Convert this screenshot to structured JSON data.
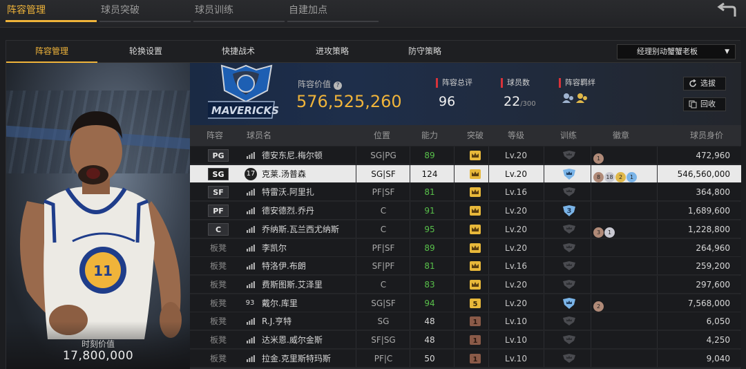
{
  "top_tabs": [
    {
      "label": "阵容管理",
      "active": true
    },
    {
      "label": "球员突破",
      "active": false
    },
    {
      "label": "球员训练",
      "active": false
    },
    {
      "label": "自建加点",
      "active": false
    }
  ],
  "sub_tabs": [
    {
      "label": "阵容管理",
      "active": true
    },
    {
      "label": "轮换设置",
      "active": false
    },
    {
      "label": "快捷战术",
      "active": false
    },
    {
      "label": "进攻策略",
      "active": false
    },
    {
      "label": "防守策略",
      "active": false
    }
  ],
  "dropdown": {
    "selected": "经理别动蟹蟹老板"
  },
  "player_card": {
    "value_label": "时刻价值",
    "value": "17,800,000"
  },
  "team": {
    "logo_icon": "mavericks-logo",
    "logo_text": "MAVERICKS",
    "lineup_value_label": "阵容价值",
    "lineup_value": "576,525,260",
    "rating_label": "阵容总评",
    "rating": "96",
    "count_label": "球员数",
    "count": "22",
    "count_max": "/300",
    "bond_label": "阵容羁绊",
    "select_button": "选拔",
    "recall_button": "回收"
  },
  "table": {
    "headers": [
      "阵容",
      "球员名",
      "位置",
      "能力",
      "突破",
      "等级",
      "训练",
      "徽章",
      "球员身价"
    ],
    "rows": [
      {
        "slot": "PG",
        "bench": false,
        "num": "",
        "name": "德安东尼.梅尔顿",
        "pos": "SG|PG",
        "ability": "89",
        "green": true,
        "brk": "crown-gold",
        "brk_text": "",
        "level": "Lv.20",
        "train": "gray",
        "train_text": "",
        "badges": [
          {
            "t": "1",
            "c": "#b08a78"
          }
        ],
        "price": "472,960",
        "selected": false
      },
      {
        "slot": "SG",
        "bench": false,
        "num": "17",
        "name": "克莱.汤普森",
        "pos": "SG|SF",
        "ability": "124",
        "green": false,
        "brk": "crown-gold",
        "brk_text": "",
        "level": "Lv.20",
        "train": "blue-crown",
        "train_text": "",
        "badges": [
          {
            "t": "8",
            "c": "#b08a78"
          },
          {
            "t": "18",
            "c": "#c9c9d2"
          },
          {
            "t": "2",
            "c": "#e0b84a"
          },
          {
            "t": "1",
            "c": "#7ab4e8"
          }
        ],
        "price": "546,560,000",
        "selected": true
      },
      {
        "slot": "SF",
        "bench": false,
        "num": "",
        "name": "特雷沃.阿里扎",
        "pos": "PF|SF",
        "ability": "81",
        "green": true,
        "brk": "crown-gold",
        "brk_text": "",
        "level": "Lv.16",
        "train": "gray",
        "train_text": "",
        "badges": [],
        "price": "364,800",
        "selected": false
      },
      {
        "slot": "PF",
        "bench": false,
        "num": "",
        "name": "德安德烈.乔丹",
        "pos": "C",
        "ability": "91",
        "green": true,
        "brk": "crown-gold",
        "brk_text": "",
        "level": "Lv.20",
        "train": "blue-num",
        "train_text": "3",
        "badges": [],
        "price": "1,689,600",
        "selected": false
      },
      {
        "slot": "C",
        "bench": false,
        "num": "",
        "name": "乔纳斯.瓦兰西尤纳斯",
        "pos": "C",
        "ability": "95",
        "green": true,
        "brk": "crown-gold",
        "brk_text": "",
        "level": "Lv.20",
        "train": "gray",
        "train_text": "",
        "badges": [
          {
            "t": "3",
            "c": "#b08a78"
          },
          {
            "t": "1",
            "c": "#c9c9d2"
          }
        ],
        "price": "1,228,800",
        "selected": false
      },
      {
        "slot": "板凳",
        "bench": true,
        "num": "",
        "name": "李凯尔",
        "pos": "PF|SF",
        "ability": "89",
        "green": true,
        "brk": "crown-gold",
        "brk_text": "",
        "level": "Lv.20",
        "train": "gray",
        "train_text": "",
        "badges": [],
        "price": "264,960",
        "selected": false
      },
      {
        "slot": "板凳",
        "bench": true,
        "num": "",
        "name": "特洛伊.布朗",
        "pos": "SF|PF",
        "ability": "81",
        "green": true,
        "brk": "crown-gold",
        "brk_text": "",
        "level": "Lv.16",
        "train": "gray",
        "train_text": "",
        "badges": [],
        "price": "259,200",
        "selected": false
      },
      {
        "slot": "板凳",
        "bench": true,
        "num": "",
        "name": "费斯图斯.艾泽里",
        "pos": "C",
        "ability": "83",
        "green": true,
        "brk": "crown-gold",
        "brk_text": "",
        "level": "Lv.20",
        "train": "gray",
        "train_text": "",
        "badges": [],
        "price": "297,600",
        "selected": false
      },
      {
        "slot": "板凳",
        "bench": true,
        "num": "93",
        "name": "戴尔.库里",
        "pos": "SG|SF",
        "ability": "94",
        "green": true,
        "brk": "num-gold",
        "brk_text": "5",
        "level": "Lv.20",
        "train": "blue-crown",
        "train_text": "",
        "badges": [
          {
            "t": "2",
            "c": "#b08a78"
          }
        ],
        "price": "7,568,000",
        "selected": false
      },
      {
        "slot": "板凳",
        "bench": true,
        "num": "",
        "name": "R.J.亨特",
        "pos": "SG",
        "ability": "48",
        "green": false,
        "brk": "num-bronze",
        "brk_text": "1",
        "level": "Lv.10",
        "train": "gray",
        "train_text": "",
        "badges": [],
        "price": "6,050",
        "selected": false
      },
      {
        "slot": "板凳",
        "bench": true,
        "num": "",
        "name": "达米恩.威尔金斯",
        "pos": "SF|SG",
        "ability": "48",
        "green": false,
        "brk": "num-bronze",
        "brk_text": "1",
        "level": "Lv.10",
        "train": "gray",
        "train_text": "",
        "badges": [],
        "price": "4,250",
        "selected": false
      },
      {
        "slot": "板凳",
        "bench": true,
        "num": "",
        "name": "拉金.克里斯特玛斯",
        "pos": "PF|C",
        "ability": "50",
        "green": false,
        "brk": "num-bronze",
        "brk_text": "1",
        "level": "Lv.10",
        "train": "gray",
        "train_text": "",
        "badges": [],
        "price": "9,040",
        "selected": false
      }
    ]
  },
  "colors": {
    "accent": "#f0b43a",
    "red_marker": "#d8333a",
    "ability_green": "#58c04a"
  }
}
